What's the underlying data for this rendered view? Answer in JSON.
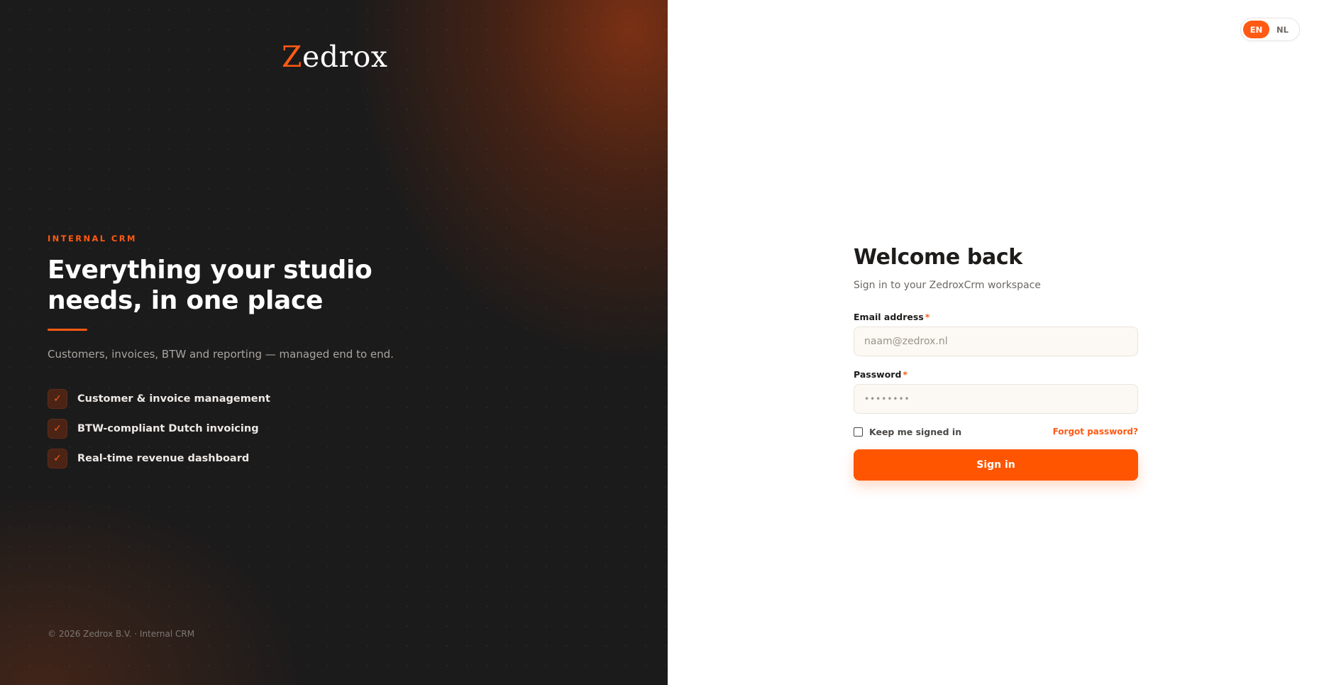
{
  "brand": {
    "logo_initial": "Z",
    "logo_rest": "edrox",
    "accent_color": "#ff5a14"
  },
  "hero": {
    "eyebrow": "INTERNAL CRM",
    "headline": "Everything your studio needs, in one place",
    "subtitle": "Customers, invoices, BTW and reporting — managed end to end.",
    "features": [
      {
        "icon": "check-icon",
        "label": "Customer & invoice management"
      },
      {
        "icon": "check-icon",
        "label": "BTW-compliant Dutch invoicing"
      },
      {
        "icon": "check-icon",
        "label": "Real-time revenue dashboard"
      }
    ],
    "footer": "© 2026 Zedrox B.V. · Internal CRM"
  },
  "language": {
    "options": [
      "EN",
      "NL"
    ],
    "selected": "EN"
  },
  "login_form": {
    "title": "Welcome back",
    "subtitle": "Sign in to your ZedroxCrm workspace",
    "email": {
      "label": "Email address",
      "required_mark": "*",
      "placeholder": "naam@zedrox.nl",
      "value": ""
    },
    "password": {
      "label": "Password",
      "required_mark": "*",
      "placeholder": "••••••••",
      "value": ""
    },
    "remember_label": "Keep me signed in",
    "remember_checked": false,
    "forgot_label": "Forgot password?",
    "submit_label": "Sign in"
  }
}
